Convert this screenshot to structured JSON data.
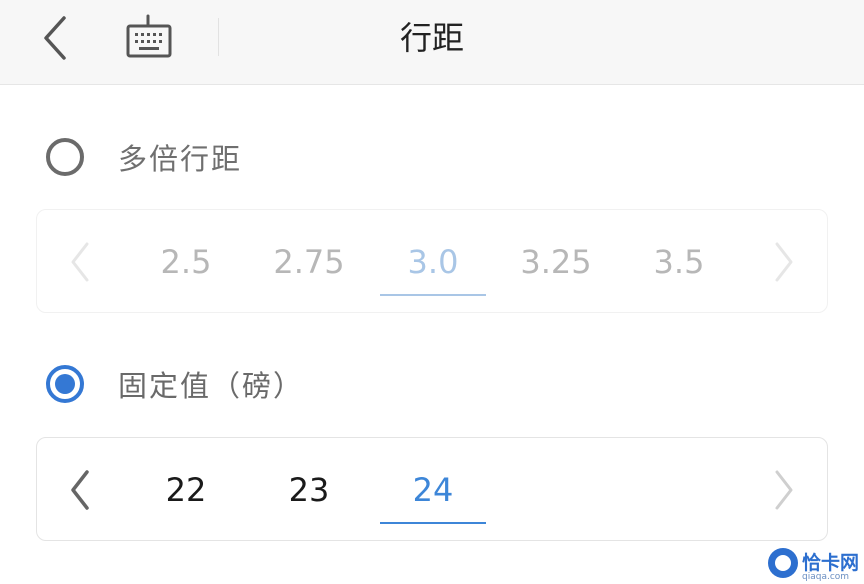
{
  "header": {
    "title": "行距",
    "back_icon": "chevron-left-icon",
    "keyboard_icon": "keyboard-icon"
  },
  "multiple": {
    "label": "多倍行距",
    "checked": false,
    "values": [
      "2.5",
      "2.75",
      "3.0",
      "3.25",
      "3.5"
    ],
    "selected_index": 2
  },
  "fixed": {
    "label": "固定值（磅）",
    "checked": true,
    "values": [
      "22",
      "23",
      "24"
    ],
    "selected_index": 2
  },
  "colors": {
    "accent": "#3478d4",
    "selected_text": "#3d86d8",
    "disabled_text": "#b7b7b7",
    "header_bg": "#f7f7f7"
  },
  "watermark": {
    "text": "恰卡网",
    "sub": "qiaqa.com"
  }
}
